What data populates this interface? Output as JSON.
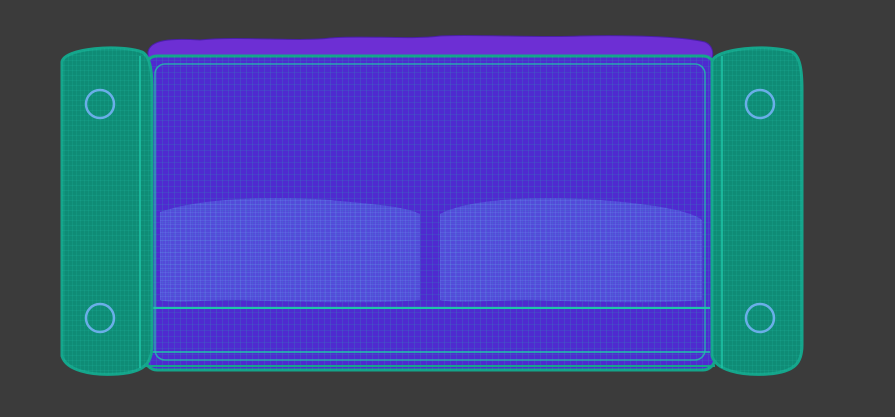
{
  "viewport": {
    "background": "#3b3b3b"
  },
  "palette": {
    "wire_teal": "#14a58b",
    "wire_teal_light": "#1fc5a8",
    "mesh_purple": "#5a2bd0",
    "mesh_purple_dark": "#4a23b8",
    "mesh_blue": "#3f4fd8",
    "ring_blue": "#6aaee8",
    "back_top": "#6f2fd6"
  },
  "icons": {
    "left_arm_top_ring": "ring-icon",
    "left_arm_bottom_ring": "ring-icon",
    "right_arm_top_ring": "ring-icon",
    "right_arm_bottom_ring": "ring-icon"
  }
}
